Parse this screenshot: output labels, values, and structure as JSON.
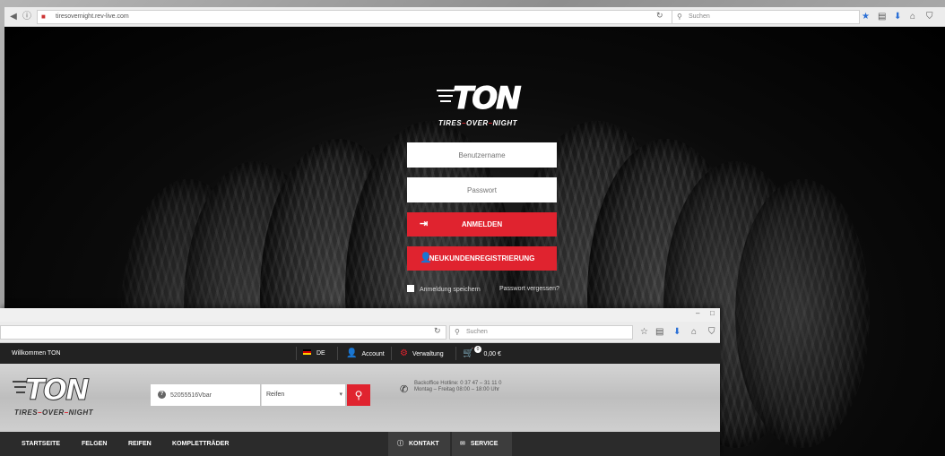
{
  "login_window": {
    "address": "tiresovernight.rev-live.com",
    "search_placeholder": "Suchen",
    "logo": {
      "mark": "TON",
      "tag_1": "TIRES",
      "tag_2": "OVER",
      "tag_3": "NIGHT",
      "sep": "–"
    },
    "username_placeholder": "Benutzername",
    "password_placeholder": "Passwort",
    "login_button": "ANMELDEN",
    "register_button": "NEUKUNDENREGISTRIERUNG",
    "remember_label": "Anmeldung speichern",
    "forgot_link": "Passwort vergessen?"
  },
  "shop_window": {
    "search_placeholder": "Suchen",
    "topbar": {
      "welcome": "Willkommen TON",
      "language": "DE",
      "account": "Account",
      "admin": "Verwaltung",
      "cart_count": "0",
      "cart_total": "0,00 €"
    },
    "search": {
      "value": "52055516Vbar",
      "category": "Reifen"
    },
    "hotline": {
      "line1": "Backoffice Hotline: 0 37 47 – 31 11 0",
      "line2": "Montag – Freitag 08:00 – 18:00 Uhr"
    },
    "nav": {
      "home": "STARTSEITE",
      "rims": "FELGEN",
      "tires": "REIFEN",
      "complete": "KOMPLETTRÄDER",
      "contact": "KONTAKT",
      "service": "SERVICE"
    }
  },
  "colors": {
    "accent_red": "#e0232f",
    "topbar": "#222222",
    "nav": "#2b2b2b"
  }
}
